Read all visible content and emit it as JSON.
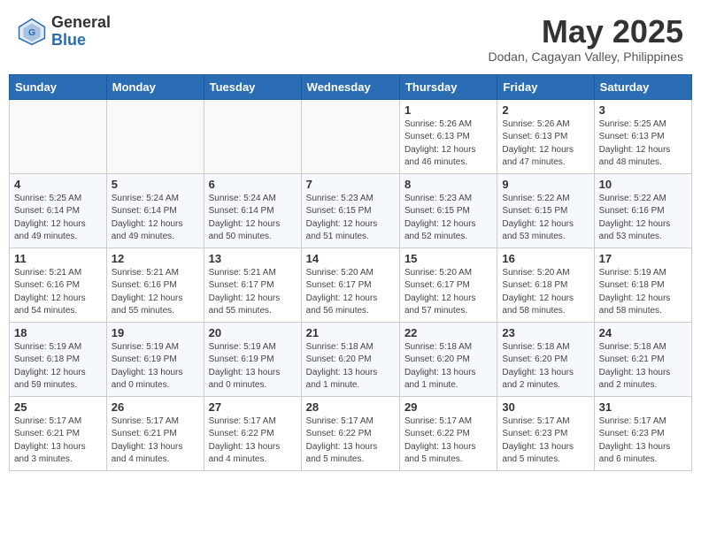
{
  "header": {
    "logo_general": "General",
    "logo_blue": "Blue",
    "month_title": "May 2025",
    "subtitle": "Dodan, Cagayan Valley, Philippines"
  },
  "weekdays": [
    "Sunday",
    "Monday",
    "Tuesday",
    "Wednesday",
    "Thursday",
    "Friday",
    "Saturday"
  ],
  "weeks": [
    [
      {
        "day": "",
        "info": ""
      },
      {
        "day": "",
        "info": ""
      },
      {
        "day": "",
        "info": ""
      },
      {
        "day": "",
        "info": ""
      },
      {
        "day": "1",
        "info": "Sunrise: 5:26 AM\nSunset: 6:13 PM\nDaylight: 12 hours\nand 46 minutes."
      },
      {
        "day": "2",
        "info": "Sunrise: 5:26 AM\nSunset: 6:13 PM\nDaylight: 12 hours\nand 47 minutes."
      },
      {
        "day": "3",
        "info": "Sunrise: 5:25 AM\nSunset: 6:13 PM\nDaylight: 12 hours\nand 48 minutes."
      }
    ],
    [
      {
        "day": "4",
        "info": "Sunrise: 5:25 AM\nSunset: 6:14 PM\nDaylight: 12 hours\nand 49 minutes."
      },
      {
        "day": "5",
        "info": "Sunrise: 5:24 AM\nSunset: 6:14 PM\nDaylight: 12 hours\nand 49 minutes."
      },
      {
        "day": "6",
        "info": "Sunrise: 5:24 AM\nSunset: 6:14 PM\nDaylight: 12 hours\nand 50 minutes."
      },
      {
        "day": "7",
        "info": "Sunrise: 5:23 AM\nSunset: 6:15 PM\nDaylight: 12 hours\nand 51 minutes."
      },
      {
        "day": "8",
        "info": "Sunrise: 5:23 AM\nSunset: 6:15 PM\nDaylight: 12 hours\nand 52 minutes."
      },
      {
        "day": "9",
        "info": "Sunrise: 5:22 AM\nSunset: 6:15 PM\nDaylight: 12 hours\nand 53 minutes."
      },
      {
        "day": "10",
        "info": "Sunrise: 5:22 AM\nSunset: 6:16 PM\nDaylight: 12 hours\nand 53 minutes."
      }
    ],
    [
      {
        "day": "11",
        "info": "Sunrise: 5:21 AM\nSunset: 6:16 PM\nDaylight: 12 hours\nand 54 minutes."
      },
      {
        "day": "12",
        "info": "Sunrise: 5:21 AM\nSunset: 6:16 PM\nDaylight: 12 hours\nand 55 minutes."
      },
      {
        "day": "13",
        "info": "Sunrise: 5:21 AM\nSunset: 6:17 PM\nDaylight: 12 hours\nand 55 minutes."
      },
      {
        "day": "14",
        "info": "Sunrise: 5:20 AM\nSunset: 6:17 PM\nDaylight: 12 hours\nand 56 minutes."
      },
      {
        "day": "15",
        "info": "Sunrise: 5:20 AM\nSunset: 6:17 PM\nDaylight: 12 hours\nand 57 minutes."
      },
      {
        "day": "16",
        "info": "Sunrise: 5:20 AM\nSunset: 6:18 PM\nDaylight: 12 hours\nand 58 minutes."
      },
      {
        "day": "17",
        "info": "Sunrise: 5:19 AM\nSunset: 6:18 PM\nDaylight: 12 hours\nand 58 minutes."
      }
    ],
    [
      {
        "day": "18",
        "info": "Sunrise: 5:19 AM\nSunset: 6:18 PM\nDaylight: 12 hours\nand 59 minutes."
      },
      {
        "day": "19",
        "info": "Sunrise: 5:19 AM\nSunset: 6:19 PM\nDaylight: 13 hours\nand 0 minutes."
      },
      {
        "day": "20",
        "info": "Sunrise: 5:19 AM\nSunset: 6:19 PM\nDaylight: 13 hours\nand 0 minutes."
      },
      {
        "day": "21",
        "info": "Sunrise: 5:18 AM\nSunset: 6:20 PM\nDaylight: 13 hours\nand 1 minute."
      },
      {
        "day": "22",
        "info": "Sunrise: 5:18 AM\nSunset: 6:20 PM\nDaylight: 13 hours\nand 1 minute."
      },
      {
        "day": "23",
        "info": "Sunrise: 5:18 AM\nSunset: 6:20 PM\nDaylight: 13 hours\nand 2 minutes."
      },
      {
        "day": "24",
        "info": "Sunrise: 5:18 AM\nSunset: 6:21 PM\nDaylight: 13 hours\nand 2 minutes."
      }
    ],
    [
      {
        "day": "25",
        "info": "Sunrise: 5:17 AM\nSunset: 6:21 PM\nDaylight: 13 hours\nand 3 minutes."
      },
      {
        "day": "26",
        "info": "Sunrise: 5:17 AM\nSunset: 6:21 PM\nDaylight: 13 hours\nand 4 minutes."
      },
      {
        "day": "27",
        "info": "Sunrise: 5:17 AM\nSunset: 6:22 PM\nDaylight: 13 hours\nand 4 minutes."
      },
      {
        "day": "28",
        "info": "Sunrise: 5:17 AM\nSunset: 6:22 PM\nDaylight: 13 hours\nand 5 minutes."
      },
      {
        "day": "29",
        "info": "Sunrise: 5:17 AM\nSunset: 6:22 PM\nDaylight: 13 hours\nand 5 minutes."
      },
      {
        "day": "30",
        "info": "Sunrise: 5:17 AM\nSunset: 6:23 PM\nDaylight: 13 hours\nand 5 minutes."
      },
      {
        "day": "31",
        "info": "Sunrise: 5:17 AM\nSunset: 6:23 PM\nDaylight: 13 hours\nand 6 minutes."
      }
    ]
  ]
}
